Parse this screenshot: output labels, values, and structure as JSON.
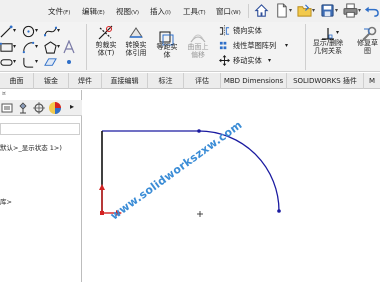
{
  "menu": [
    {
      "label": "文件",
      "accel": "(F)"
    },
    {
      "label": "编辑",
      "accel": "(E)"
    },
    {
      "label": "视图",
      "accel": "(V)"
    },
    {
      "label": "插入",
      "accel": "(I)"
    },
    {
      "label": "工具",
      "accel": "(T)"
    },
    {
      "label": "窗口",
      "accel": "(W)"
    }
  ],
  "ribbon": {
    "trim": "剪裁实\n体(T)",
    "convert": "转换实\n体引用",
    "offset": "等距实\n体",
    "surface_offset": "曲面上\n偏移",
    "mirror": "镜向实体",
    "linear_pattern": "线性草图阵列",
    "move": "移动实体",
    "display_relations": "显示/删除\n几何关系",
    "repair": "修复草\n图"
  },
  "tabs": [
    "曲面",
    "钣金",
    "焊件",
    "直接编辑",
    "标注",
    "评估",
    "MBD Dimensions",
    "SOLIDWORKS 插件",
    "M"
  ],
  "left_panel": {
    "config_text": "默认>_显示状态 1>)",
    "item_text": "库>"
  },
  "watermark": "www.solidworkszxw.com",
  "colors": {
    "sketch": "#1a1aa0",
    "origin": "#d42222",
    "accent_blue": "#2f6fc8"
  }
}
